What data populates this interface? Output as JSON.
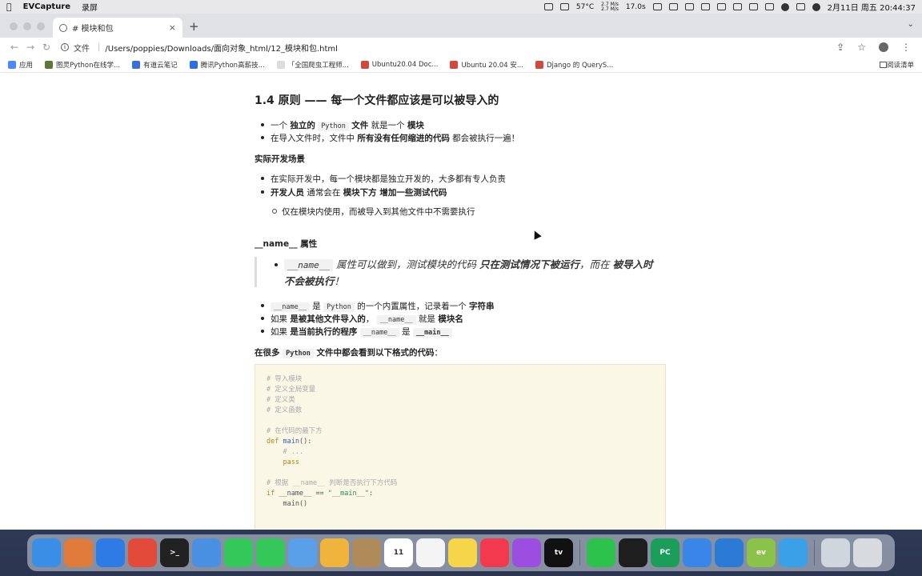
{
  "menubar": {
    "app_name": "EVCapture",
    "menu_item": "录屏",
    "weather": "57°C",
    "net_up": "2.7 M/s",
    "net_down": "2.7 M/s",
    "battery_time": "17.0s",
    "date_time": "2月11日 周五 20:44:37"
  },
  "browser": {
    "tab_title": "# 模块和包",
    "address_label": "文件",
    "address_path": "/Users/poppies/Downloads/面向对象_html/12_模块和包.html",
    "bookmarks": [
      {
        "label": "应用",
        "color": "#4c8bf5"
      },
      {
        "label": "图灵Python在线学...",
        "color": "#5a7a3a"
      },
      {
        "label": "有道云笔记",
        "color": "#3b6fd8"
      },
      {
        "label": "腾讯Python高薪技...",
        "color": "#2b6fe8"
      },
      {
        "label": "「全国爬虫工程师...",
        "color": "#dcdcdc"
      },
      {
        "label": "Ubuntu20.04 Doc...",
        "color": "#d04a3c"
      },
      {
        "label": "Ubuntu 20.04 安...",
        "color": "#d04a3c"
      },
      {
        "label": "Django 的 QueryS...",
        "color": "#d04a3c"
      }
    ],
    "reading_list": "阅读清单"
  },
  "article": {
    "heading": "1.4 原则 —— 每一个文件都应该是可以被导入的",
    "b1": {
      "t1": "一个 ",
      "b1": "独立的",
      "code": "Python",
      "b2": "文件",
      "t2": " 就是一个 ",
      "b3": "模块"
    },
    "b2": {
      "t1": "在导入文件时，文件中 ",
      "b1": "所有没有任何缩进的代码",
      "t2": " 都会被执行一遍！"
    },
    "scenario_title": "实际开发场景",
    "b3": "在实际开发中，每一个模块都是独立开发的，大多都有专人负责",
    "b4": {
      "b1": "开发人员",
      "t1": " 通常会在 ",
      "b2": "模块下方 增加一些测试代码"
    },
    "sub1": "仅在模块内使用，而被导入到其他文件中不需要执行",
    "name_attr_title": "__name__ 属性",
    "quote": {
      "code": "__name__",
      "t1": " 属性可以做到，测试模块的代码 ",
      "b1": "只在测试情况下被运行",
      "t2": "，而在 ",
      "b2": "被导入时",
      "b3": "不会被执行",
      "t3": "！"
    },
    "b5": {
      "code1": "__name__",
      "t1": " 是 ",
      "code2": "Python",
      "t2": " 的一个内置属性，记录着一个 ",
      "b1": "字符串"
    },
    "b6": {
      "t1": "如果 ",
      "b1": "是被其他文件导入的",
      "t2": "，",
      "code": "__name__",
      "t3": " 就是 ",
      "b2": "模块名"
    },
    "b7": {
      "t1": "如果 ",
      "b1": "是当前执行的程序",
      "code1": "__name__",
      "t2": " 是 ",
      "code2": "__main__"
    },
    "code_intro": {
      "b1": "在很多 ",
      "code": "Python",
      "b2": " 文件中都会看到以下格式的代码",
      "t1": "："
    },
    "code_lines": [
      {
        "kind": "com",
        "text": "# 导入模块"
      },
      {
        "kind": "com",
        "text": "# 定义全局变量"
      },
      {
        "kind": "com",
        "text": "# 定义类"
      },
      {
        "kind": "com",
        "text": "# 定义函数"
      },
      {
        "kind": "blank",
        "text": ""
      },
      {
        "kind": "com",
        "text": "# 在代码的最下方"
      },
      {
        "kind": "def",
        "kw": "def",
        "fn": " main",
        "rest": "():"
      },
      {
        "kind": "com",
        "text": "    # ..."
      },
      {
        "kind": "kwline",
        "text": "    pass"
      },
      {
        "kind": "blank",
        "text": ""
      },
      {
        "kind": "com",
        "text": "# 根据 __name__ 判断是否执行下方代码"
      },
      {
        "kind": "if",
        "kw": "if",
        "rest": " __name__ == ",
        "str": "\"__main__\"",
        "end": ":"
      },
      {
        "kind": "plain",
        "text": "    main()"
      }
    ]
  },
  "dock": {
    "apps": [
      {
        "name": "finder",
        "color": "#3a8ee6",
        "label": ""
      },
      {
        "name": "launchpad",
        "color": "#e07a3a",
        "label": ""
      },
      {
        "name": "safari",
        "color": "#2f7be6",
        "label": ""
      },
      {
        "name": "chrome",
        "color": "#e24a3a",
        "label": ""
      },
      {
        "name": "terminal",
        "color": "#222222",
        "label": ">_"
      },
      {
        "name": "mail",
        "color": "#4a90e2",
        "label": ""
      },
      {
        "name": "facetime",
        "color": "#34c759",
        "label": ""
      },
      {
        "name": "messages",
        "color": "#34c759",
        "label": ""
      },
      {
        "name": "maps",
        "color": "#5aa0e8",
        "label": ""
      },
      {
        "name": "photos",
        "color": "#f0b43c",
        "label": ""
      },
      {
        "name": "contacts",
        "color": "#b08b5a",
        "label": ""
      },
      {
        "name": "calendar",
        "color": "#ffffff",
        "label": "11"
      },
      {
        "name": "reminders",
        "color": "#f4f4f4",
        "label": ""
      },
      {
        "name": "notes",
        "color": "#f7d54a",
        "label": ""
      },
      {
        "name": "music",
        "color": "#f2394e",
        "label": ""
      },
      {
        "name": "podcasts",
        "color": "#9b4ee0",
        "label": ""
      },
      {
        "name": "tv",
        "color": "#111111",
        "label": "tv"
      },
      {
        "name": "wechat",
        "color": "#2dc24b",
        "label": ""
      },
      {
        "name": "qq",
        "color": "#1e1e1e",
        "label": ""
      },
      {
        "name": "pycharm",
        "color": "#1b9e5a",
        "label": "PC"
      },
      {
        "name": "baidunetdisk",
        "color": "#3a86e8",
        "label": ""
      },
      {
        "name": "vscode",
        "color": "#2b7bd6",
        "label": ""
      },
      {
        "name": "evcapture",
        "color": "#8bc34a",
        "label": "ev"
      },
      {
        "name": "qqmessage",
        "color": "#3aa0e8",
        "label": ""
      },
      {
        "name": "downloads",
        "color": "#cfd6de",
        "label": ""
      },
      {
        "name": "trash",
        "color": "#d7dbe0",
        "label": ""
      }
    ]
  }
}
